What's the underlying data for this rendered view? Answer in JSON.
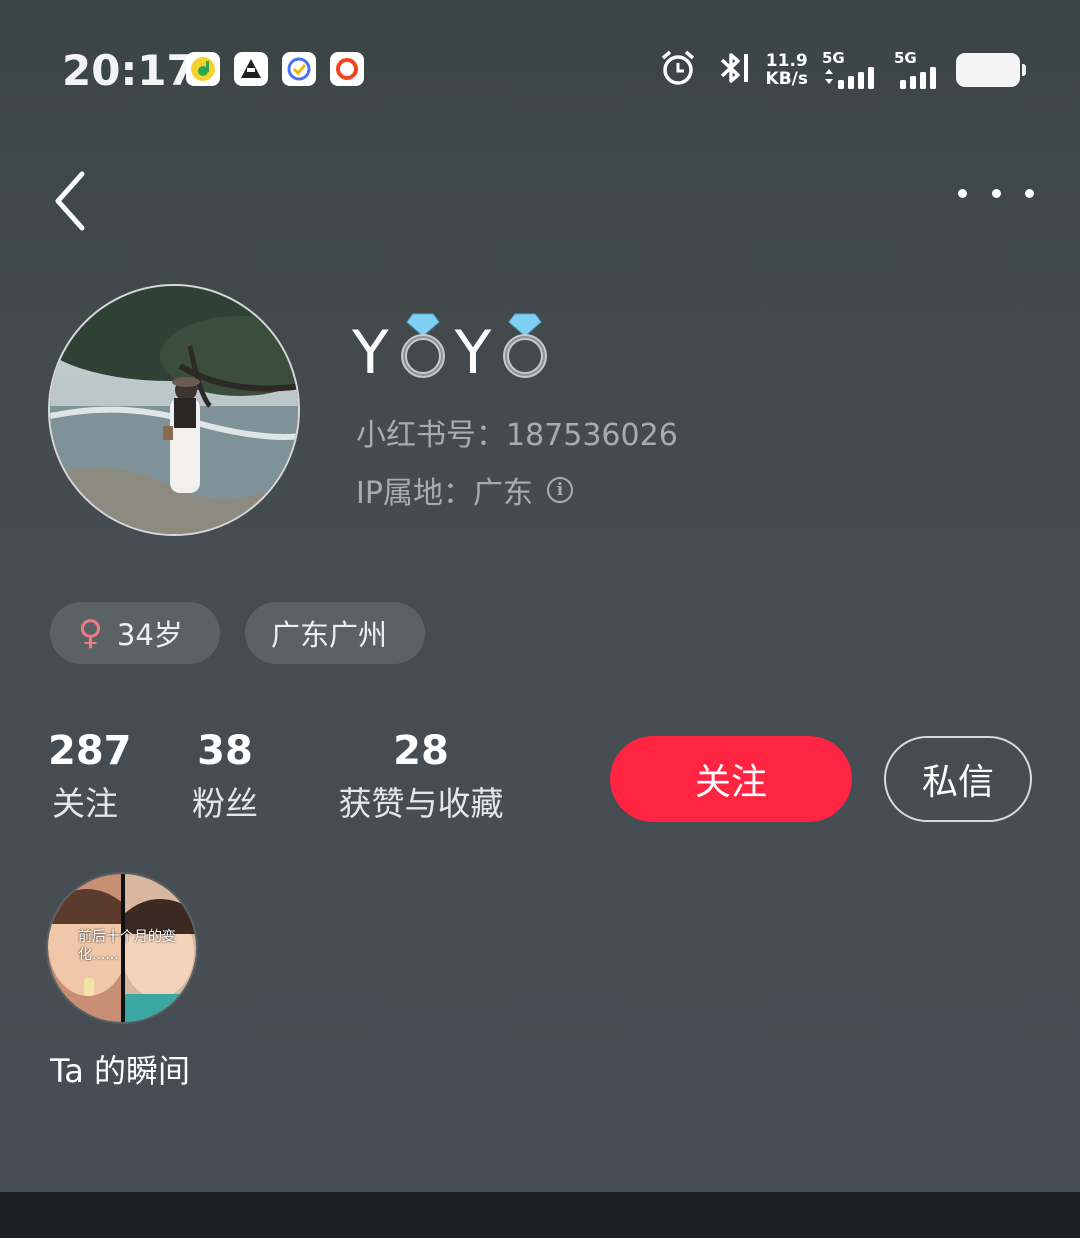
{
  "status_bar": {
    "time": "20:17",
    "net_speed_value": "11.9",
    "net_speed_unit": "KB/s",
    "sim1_label": "5G",
    "sim2_label": "5G",
    "notification_icons": [
      "qq-music-icon",
      "app-icon",
      "ticktick-icon",
      "record-icon"
    ]
  },
  "nav": {
    "back_icon": "chevron-left-icon",
    "more_icon": "more-dots-icon"
  },
  "profile": {
    "nickname_parts": [
      "Y",
      "Y"
    ],
    "nickname_emoji": "💍",
    "red_id": "小红书号：187536026",
    "ip_location": "IP属地：广东",
    "info_icon_glyph": "i"
  },
  "tags": {
    "gender_symbol": "♀",
    "age": "34岁",
    "location": "广东广州"
  },
  "stats": [
    {
      "value": "287",
      "label": "关注"
    },
    {
      "value": "38",
      "label": "粉丝"
    },
    {
      "value": "28",
      "label": "获赞与收藏"
    }
  ],
  "actions": {
    "follow_label": "关注",
    "message_label": "私信"
  },
  "moments": {
    "thumbnail_caption": "前后十个月的变化......",
    "section_label": "Ta 的瞬间"
  },
  "colors": {
    "accent": "#ff2442",
    "gender_female": "#f07a84",
    "secondary_text": "#a7acaf"
  }
}
